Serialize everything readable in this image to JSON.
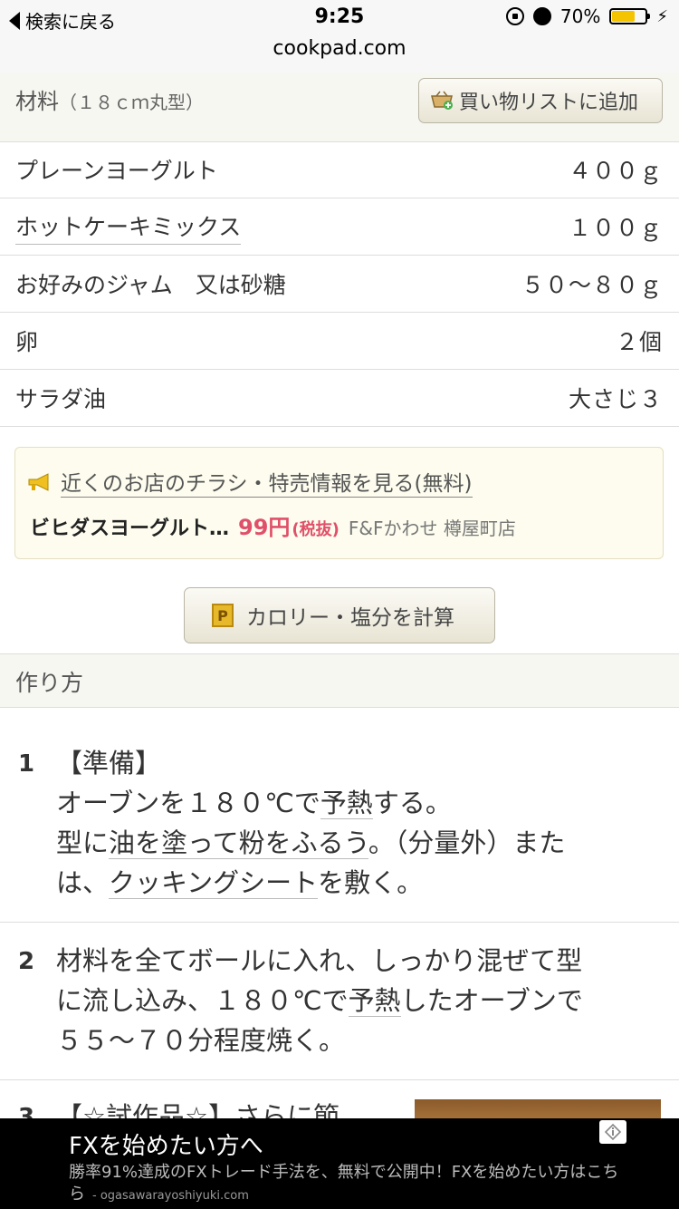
{
  "status_bar": {
    "back_label": "検索に戻る",
    "time": "9:25",
    "battery_text": "70%",
    "battery_level": 0.7
  },
  "url": "cookpad.com",
  "ingredients": {
    "title": "材料",
    "subtitle": "（１８ｃｍ丸型）",
    "shop_button": "買い物リストに追加",
    "items": [
      {
        "name": "プレーンヨーグルト",
        "qty": "４００ｇ"
      },
      {
        "name": "ホットケーキミックス",
        "qty": "１００ｇ"
      },
      {
        "name": "お好みのジャム　又は砂糖",
        "qty": "５０〜８０ｇ"
      },
      {
        "name": "卵",
        "qty": "２個"
      },
      {
        "name": "サラダ油",
        "qty": "大さじ３"
      }
    ]
  },
  "flyer_ad": {
    "link_text": "近くのお店のチラシ・特売情報を見る(無料)",
    "product": "ビヒダスヨーグルト…",
    "price": "99円",
    "tax": "(税抜)",
    "store": "F&Fかわせ 樽屋町店"
  },
  "calorie_button": "カロリー・塩分を計算",
  "steps_title": "作り方",
  "steps": [
    {
      "number": "1",
      "lines": [
        {
          "pre": "【準備】",
          "u": "",
          "post": ""
        },
        {
          "pre": "オーブンを１８０℃で",
          "u": "予熱",
          "post": "する。"
        },
        {
          "pre": "型に",
          "u": "油を塗って粉をふるう",
          "post": "。（分量外）また"
        },
        {
          "pre": "は、",
          "u": "クッキングシート",
          "post": "を敷く。"
        }
      ]
    },
    {
      "number": "2",
      "lines": [
        {
          "pre": "材料を全てボールに入れ、しっかり混ぜて型",
          "u": "",
          "post": ""
        },
        {
          "pre": "に流し込み、１８０℃で",
          "u": "予熱",
          "post": "したオーブンで"
        },
        {
          "pre": "５５〜７０分程度焼く。",
          "u": "",
          "post": ""
        }
      ]
    },
    {
      "number": "3",
      "lines": [
        {
          "pre": "【☆試作品☆】さらに節",
          "u": "",
          "post": ""
        }
      ]
    }
  ],
  "banner_ad": {
    "title": "FXを始めたい方へ",
    "description": "勝率91%達成のFXトレード手法を、無料で公開中！FXを始めたい方はこちら",
    "domain": "- ogasawarayoshiyuki.com"
  }
}
